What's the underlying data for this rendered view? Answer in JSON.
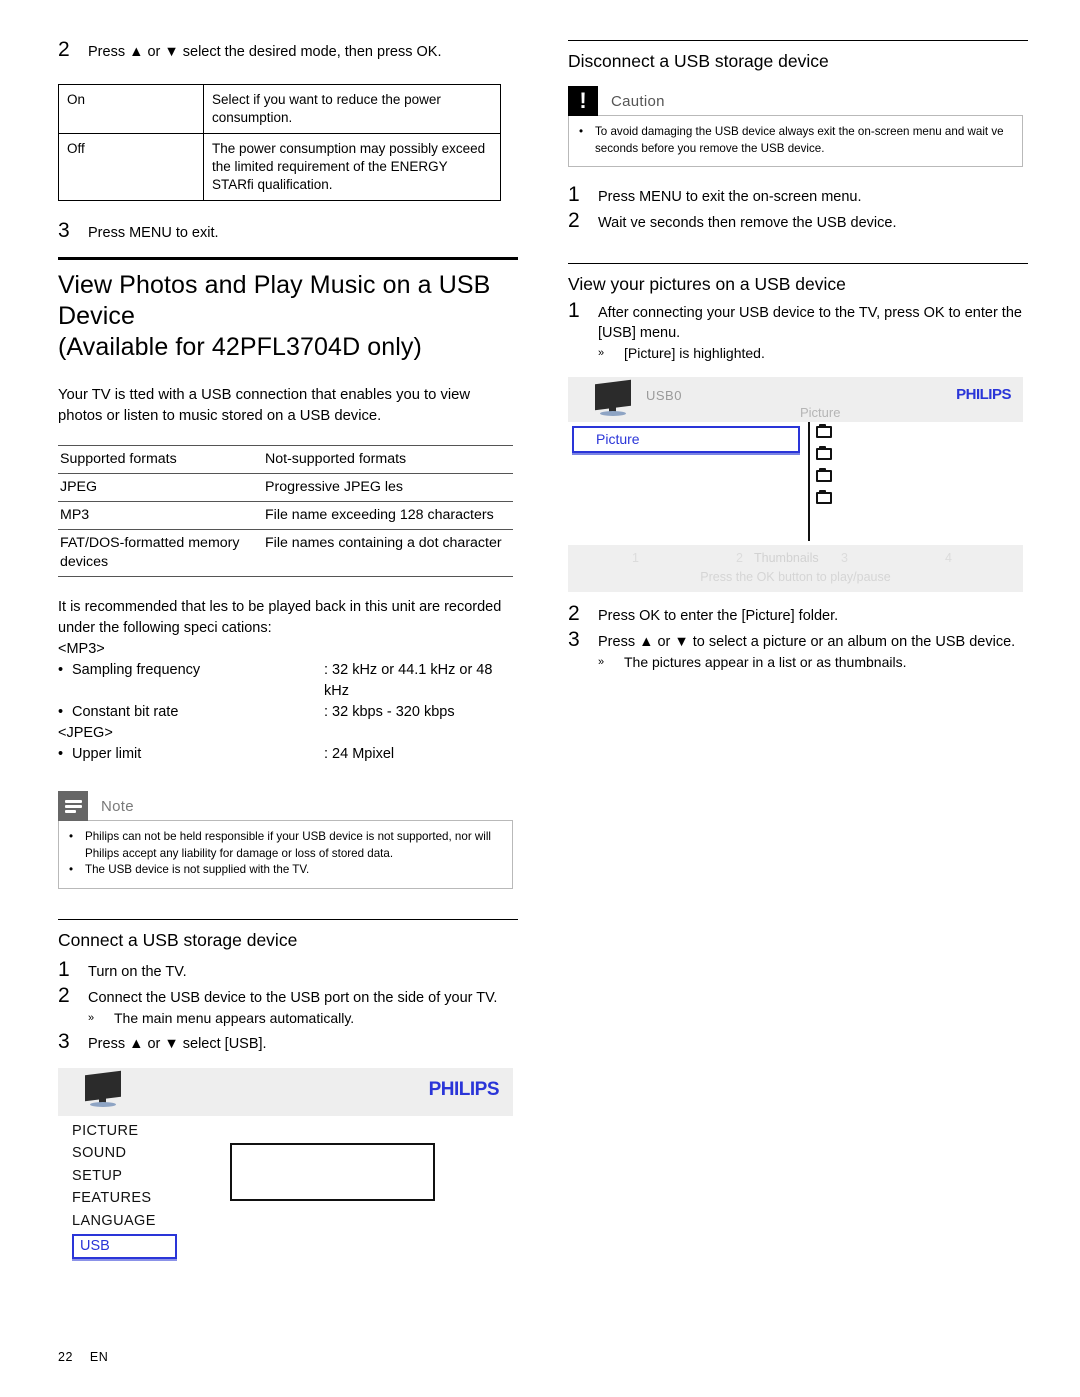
{
  "left_column": {
    "step2": {
      "num": "2",
      "text": "Press ▲ or ▼ select the desired mode, then press OK."
    },
    "mode_table": {
      "rows": [
        {
          "key": "On",
          "value": "Select if you want to reduce the power consumption."
        },
        {
          "key": "Off",
          "value": "The power consumption may possibly exceed the limited requirement of the ENERGY STARfi qualification."
        }
      ]
    },
    "step3": {
      "num": "3",
      "text": "Press MENU to exit."
    },
    "section": {
      "title": "View Photos and Play Music on a USB Device (Available for 42PFL3704D only)",
      "title_line1": "View Photos and Play Music on a USB",
      "title_line2": "Device",
      "title_line3": "(Available for 42PFL3704D only)",
      "intro": "Your TV is  tted with a USB connection that enables you to view photos or listen to music stored on a USB device."
    },
    "format_table": {
      "headers": [
        "Supported formats",
        "Not-supported formats"
      ],
      "rows": [
        [
          "JPEG",
          "Progressive JPEG  les"
        ],
        [
          "MP3",
          "File name exceeding 128 characters"
        ],
        [
          "FAT/DOS-formatted memory devices",
          "File names containing a dot character"
        ]
      ]
    },
    "spec": {
      "intro": "It is recommended that  les to be played back in this unit are recorded under the following speci cations:",
      "groups": [
        {
          "tag": "<MP3>",
          "items": [
            {
              "label": "Sampling frequency",
              "value": ": 32 kHz or 44.1 kHz or 48 kHz"
            },
            {
              "label": "Constant bit rate",
              "value": ": 32 kbps - 320 kbps"
            }
          ]
        },
        {
          "tag": "<JPEG>",
          "items": [
            {
              "label": "Upper limit",
              "value": ": 24 Mpixel"
            }
          ]
        }
      ]
    },
    "note": {
      "title": "Note",
      "bullets": [
        "Philips can not be held responsible if your USB device is not supported, nor will Philips accept any liability for damage or loss of stored data.",
        "The USB device is not supplied with the TV."
      ]
    },
    "connect": {
      "heading": "Connect a USB storage device",
      "steps": [
        {
          "num": "1",
          "text": "Turn on the TV."
        },
        {
          "num": "2",
          "text": "Connect the USB device to the USB port on the side of your TV.",
          "sub": "The main menu appears automatically."
        },
        {
          "num": "3",
          "text": "Press ▲ or ▼ select [USB]."
        }
      ]
    },
    "osd_main": {
      "brand": "PHILIPS",
      "menu_items": [
        "PICTURE",
        "SOUND",
        "SETUP",
        "FEATURES",
        "LANGUAGE"
      ],
      "selected_item": "USB"
    }
  },
  "right_column": {
    "disconnect": {
      "heading": "Disconnect a USB storage device",
      "caution_title": "Caution",
      "caution_bullet": "To avoid damaging the USB device always exit the on-screen menu and wait  ve seconds before you remove the USB device.",
      "steps": [
        {
          "num": "1",
          "text": "Press MENU to exit the on-screen menu."
        },
        {
          "num": "2",
          "text": "Wait  ve seconds then remove the USB device."
        }
      ]
    },
    "view_pictures": {
      "heading": "View your pictures on a USB device",
      "step1": {
        "num": "1",
        "text": "After connecting your USB device to the TV, press OK to enter the [USB] menu.",
        "sub": "[Picture] is highlighted."
      },
      "step2": {
        "num": "2",
        "text": "Press OK to enter the [Picture] folder."
      },
      "step3": {
        "num": "3",
        "text": "Press ▲ or ▼ to select a picture or an album on the USB device.",
        "sub": "The pictures appear in a list or as thumbnails."
      }
    },
    "osd_usb": {
      "brand": "PHILIPS",
      "device_label": "USB0",
      "breadcrumb": "Picture",
      "selected_item": "Picture",
      "folder_count": 4,
      "footer_numbers": [
        "1",
        "2",
        "3",
        "4"
      ],
      "footer_thumbnails": "Thumbnails",
      "footer_hint": "Press the OK button to play/pause"
    }
  },
  "footer": {
    "page_number": "22",
    "language": "EN"
  },
  "colors": {
    "brand_blue": "#2a35d8",
    "note_icon_gray": "#666666",
    "caution_icon_black": "#000000",
    "osd_panel_gray": "#eeeeee"
  }
}
